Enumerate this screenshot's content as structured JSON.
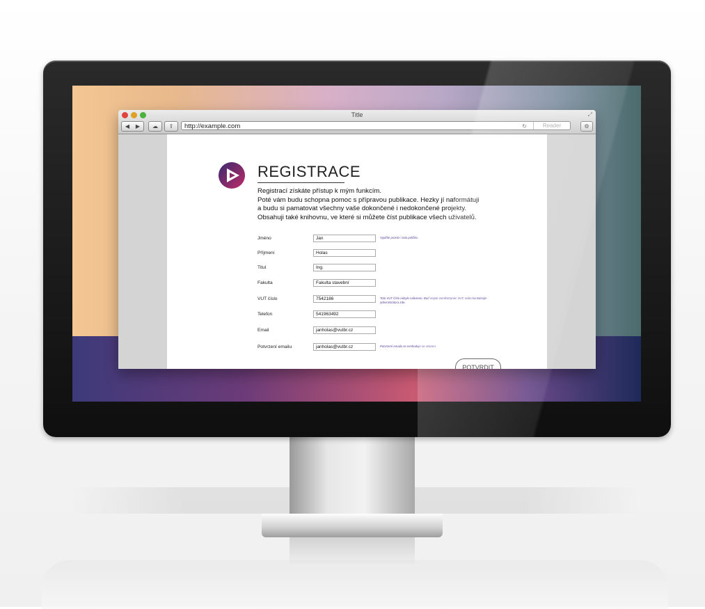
{
  "browser": {
    "window_title": "Title",
    "address": "http://example.com",
    "reader_label": "Reader",
    "back_glyph": "◀",
    "forward_glyph": "▶"
  },
  "page": {
    "heading": "REGISTRACE",
    "intro_lines": [
      "Registrací získáte přístup k mým funkcím.",
      "Poté vám budu schopna pomoc s přípravou publikace. Hezky jí naformátuji",
      "a budu si pamatovat všechny vaše dokončené i nedokončené projekty.",
      "Obsahuji také knihovnu, ve které si můžete číst publikace všech uživatelů."
    ],
    "fields": [
      {
        "label": "Jméno",
        "value": "Jan",
        "note": "Vyplňte prosím i toto políčko."
      },
      {
        "label": "Příjmení",
        "value": "Holas",
        "note": ""
      },
      {
        "label": "Titul",
        "value": "Ing.",
        "note": ""
      },
      {
        "label": "Fakulta",
        "value": "Fakulta stavební",
        "note": ""
      },
      {
        "label": "VUT číslo",
        "value": "7542186",
        "note": "Toto VUT číslo nebylo nalezeno. Buď nejste zaměstnanec VUT, nebo kontaktujte administrátora zde."
      },
      {
        "label": "Telefon",
        "value": "541963492",
        "note": ""
      },
      {
        "label": "Email",
        "value": "janholas@vutbr.cz",
        "note": ""
      },
      {
        "label": "Potvrzení emailu",
        "value": "janholas@vutbr.cz",
        "note": "Potvrzení emailu se neshoduje se vzorem."
      }
    ],
    "submit_label": "POTVRDIT"
  },
  "colors": {
    "accent": "#5a3f99",
    "logo_gradient_start": "#3a2a70",
    "logo_gradient_end": "#c0296a"
  },
  "icons": {
    "logo": "play-triangle-icon",
    "cloud": "cloud-icon",
    "share": "share-icon",
    "gear": "gear-icon",
    "reload": "reload-icon"
  }
}
